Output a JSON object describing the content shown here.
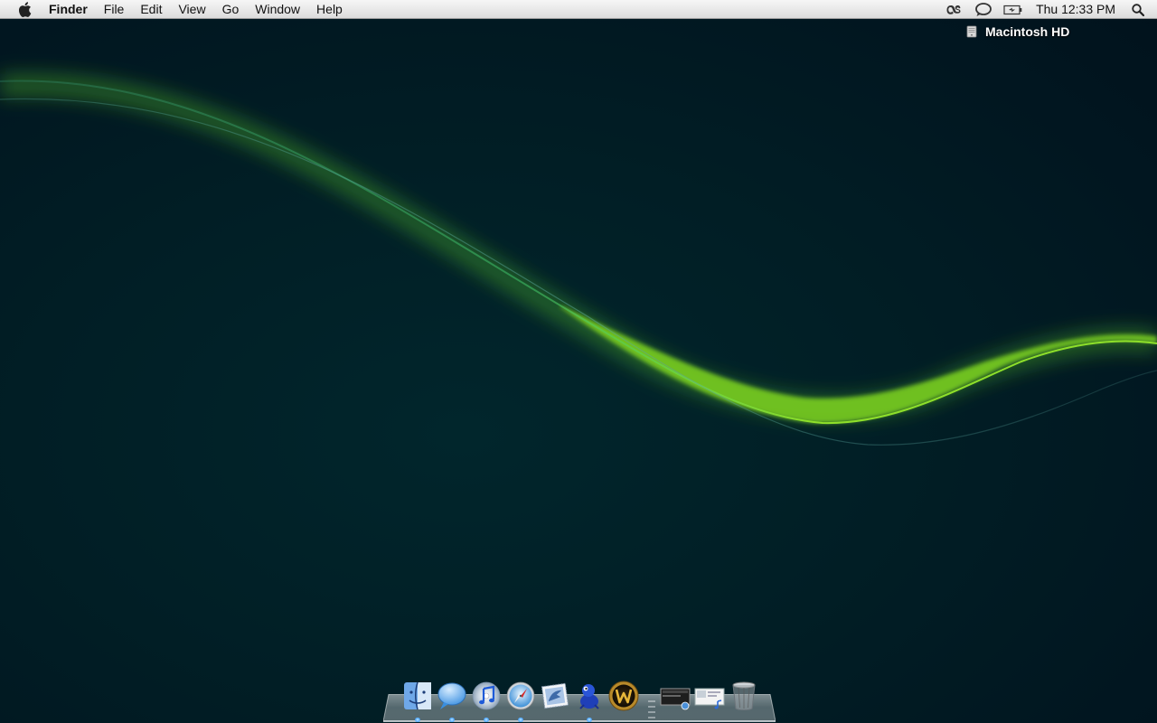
{
  "menubar": {
    "apple_icon": "apple-icon",
    "app_name": "Finder",
    "menus": [
      "File",
      "Edit",
      "View",
      "Go",
      "Window",
      "Help"
    ],
    "status_icons": [
      "lastfm-icon",
      "speech-bubble-icon",
      "battery-icon"
    ],
    "clock": "Thu 12:33 PM",
    "spotlight_icon": "magnifier-icon"
  },
  "desktop": {
    "drive_label": "Macintosh HD",
    "drive_icon": "hard-drive-icon"
  },
  "dock": {
    "apps": [
      {
        "name": "finder-icon",
        "running": true
      },
      {
        "name": "ichat-icon",
        "running": true
      },
      {
        "name": "itunes-icon",
        "running": true
      },
      {
        "name": "safari-icon",
        "running": true
      },
      {
        "name": "mail-icon",
        "running": false
      },
      {
        "name": "adium-icon",
        "running": true
      },
      {
        "name": "world-of-warcraft-icon",
        "running": false
      }
    ],
    "stacks": [
      "downloads-stack-icon",
      "music-stack-icon"
    ],
    "trash": "trash-icon"
  },
  "colors": {
    "desktop_bg": "#011e25",
    "wave_green": "#7ed321",
    "menubar_bg": "#e8e8e8"
  }
}
